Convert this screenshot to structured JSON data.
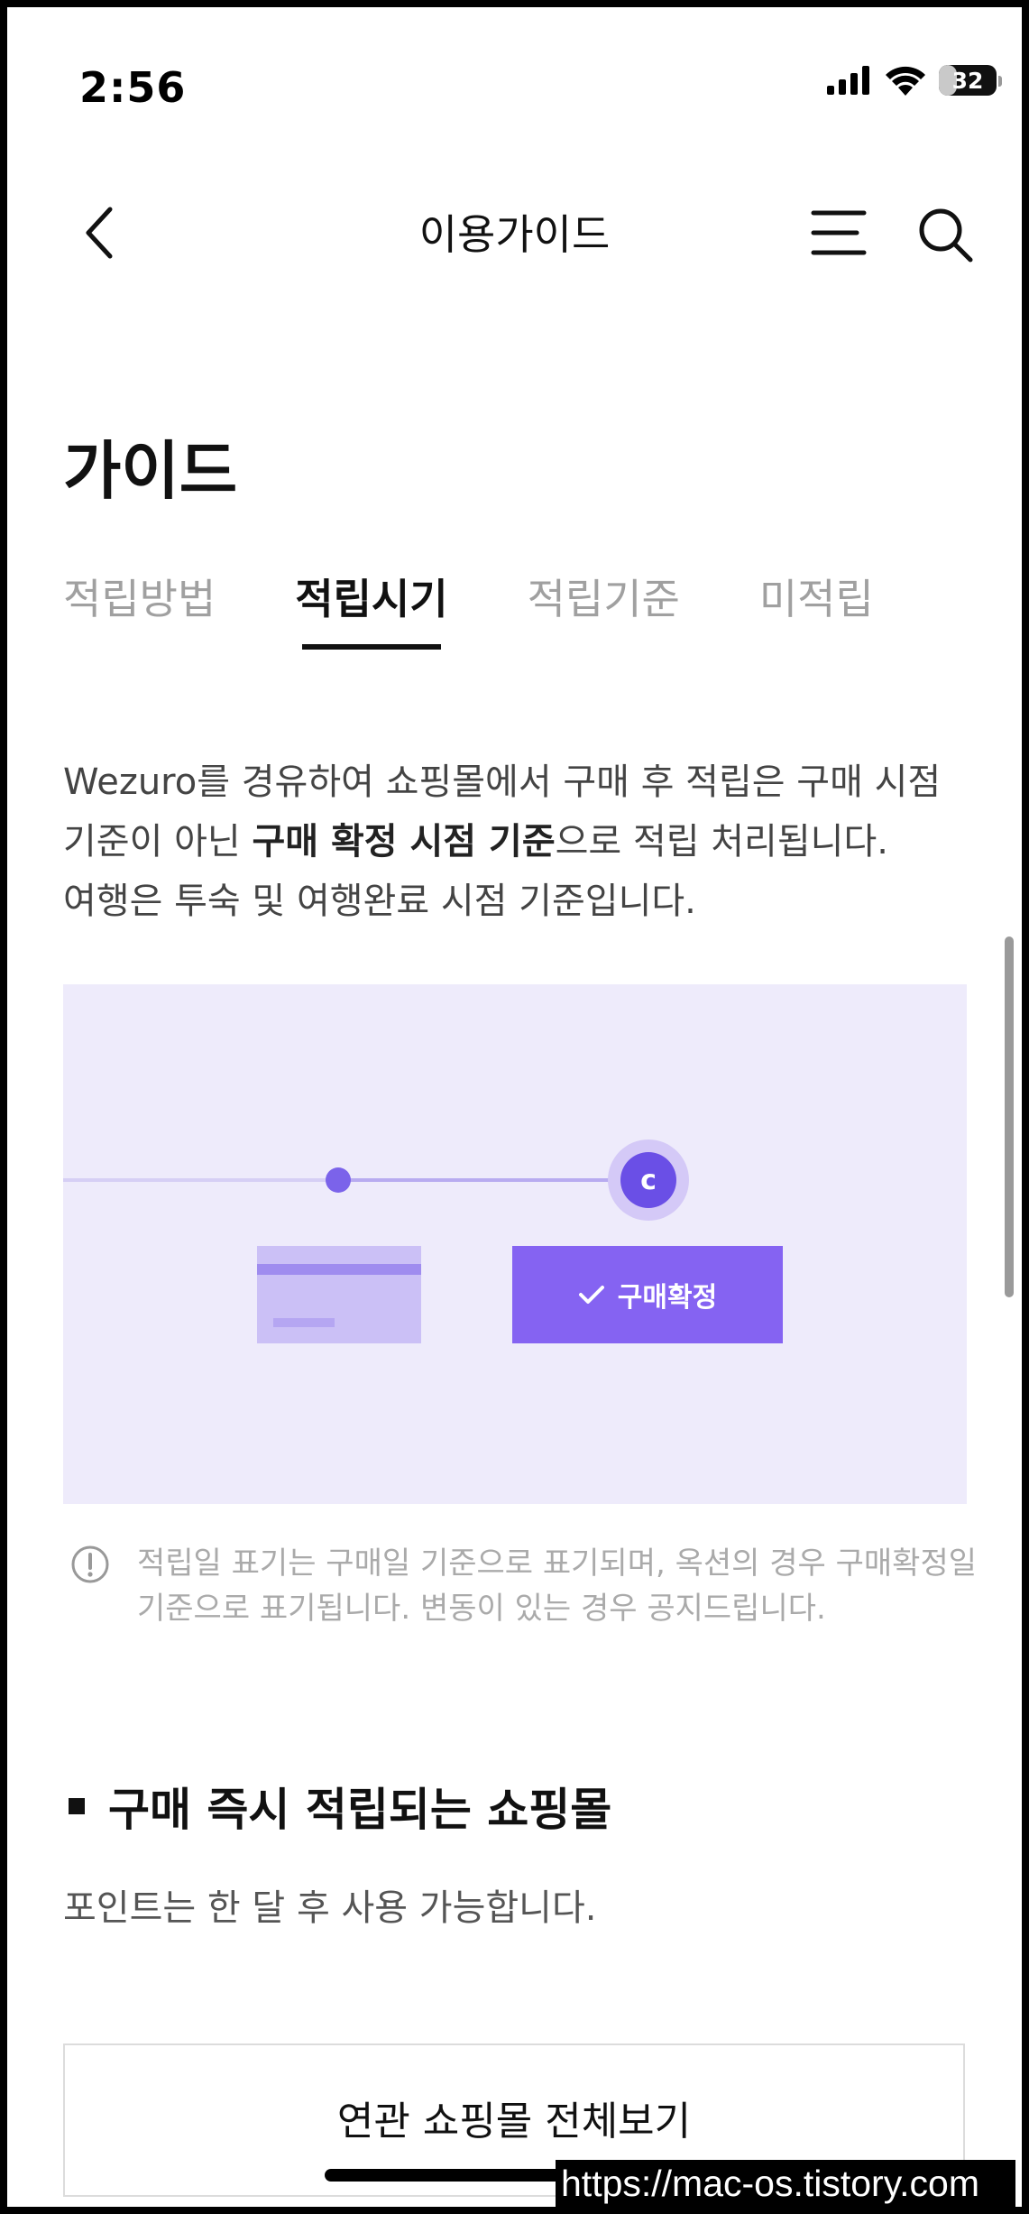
{
  "status_bar": {
    "time": "2:56",
    "battery": "32",
    "battery_level": 0.32,
    "icons": [
      "signal-icon",
      "wifi-icon",
      "battery-icon"
    ]
  },
  "nav": {
    "title": "이용가이드",
    "icons": [
      "chevron-left-icon",
      "hamburger-menu-icon",
      "search-icon"
    ]
  },
  "page": {
    "heading": "가이드",
    "tabs": [
      {
        "label": "적립방법",
        "active": false
      },
      {
        "label": "적립시기",
        "active": true
      },
      {
        "label": "적립기준",
        "active": false
      },
      {
        "label": "미적립",
        "active": false
      }
    ],
    "description": {
      "part1": "Wezuro를 경유하여 쇼핑몰에서 구매 후 적립은 구매 시점 기준이 아닌 ",
      "bold": "구매 확정 시점 기준",
      "part2": "으로 적립 처리됩니다.",
      "line2": "여행은 투숙 및 여행완료 시점 기준입니다."
    },
    "illustration": {
      "coin_label": "c",
      "confirm_label": "구매확정",
      "colors": {
        "background": "#eeebfb",
        "accent": "#8563f2",
        "coin": "#6a4fe6"
      }
    },
    "note": "적립일 표기는 구매일 기준으로 표기되며, 옥션의 경우 구매확정일 기준으로 표기됩니다. 변동이 있는 경우 공지드립니다.",
    "section": {
      "title": "구매 즉시 적립되는 쇼핑몰",
      "subtitle": "포인트는 한 달 후 사용 가능합니다.",
      "button_label": "연관 쇼핑몰 전체보기"
    }
  },
  "watermark": "https://mac-os.tistory.com"
}
